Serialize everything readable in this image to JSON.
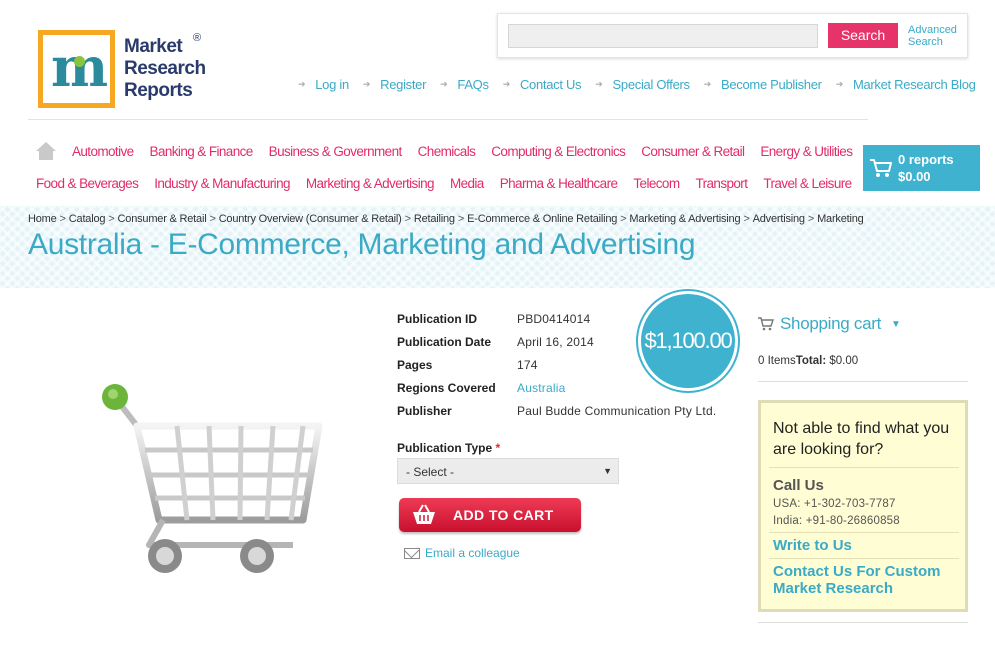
{
  "brand": {
    "logo_letter": "m",
    "logo_lines": [
      "Market",
      "Research",
      "Reports"
    ],
    "registered": "®"
  },
  "search": {
    "placeholder": "",
    "button_label": "Search",
    "advanced_label": "Advanced Search"
  },
  "top_links": [
    "Log in",
    "Register",
    "FAQs",
    "Contact Us",
    "Special Offers",
    "Become Publisher",
    "Market Research Blog"
  ],
  "categories_row1": [
    "Automotive",
    "Banking & Finance",
    "Business & Government",
    "Chemicals",
    "Computing & Electronics",
    "Consumer & Retail",
    "Energy & Utilities"
  ],
  "categories_row2": [
    "Food & Beverages",
    "Industry & Manufacturing",
    "Marketing & Advertising",
    "Media",
    "Pharma & Healthcare",
    "Telecom",
    "Transport",
    "Travel & Leisure"
  ],
  "cart_summary": {
    "reports": "0 reports",
    "amount": "$0.00"
  },
  "breadcrumb": [
    "Home",
    "Catalog",
    "Consumer & Retail",
    "Country Overview (Consumer & Retail)",
    "Retailing",
    "E-Commerce & Online Retailing",
    "Marketing & Advertising",
    "Advertising",
    "Marketing"
  ],
  "page_title": "Australia - E-Commerce, Marketing and Advertising",
  "details": {
    "publication_id_label": "Publication ID",
    "publication_id": "PBD0414014",
    "publication_date_label": "Publication Date",
    "publication_date": "April 16, 2014",
    "pages_label": "Pages",
    "pages": "174",
    "regions_label": "Regions Covered",
    "regions": "Australia",
    "publisher_label": "Publisher",
    "publisher": "Paul Budde Communication Pty Ltd."
  },
  "price": "$1,100.00",
  "publication_type": {
    "label": "Publication Type",
    "required_mark": "*",
    "selected": "- Select -"
  },
  "add_to_cart_label": "ADD TO CART",
  "email_colleague_label": "Email a colleague",
  "shopping_cart": {
    "title": "Shopping cart",
    "items_text": "0 Items",
    "total_label": "Total:",
    "total_value": "$0.00"
  },
  "help_box": {
    "question": "Not able to find what you are looking for?",
    "call_us": "Call Us",
    "usa": "USA: +1-302-703-7787",
    "india": "India: +91-80-26860858",
    "write_to_us": "Write to Us",
    "custom_research": "Contact Us For Custom Market Research"
  },
  "colors": {
    "brand_blue": "#3aaac6",
    "category_pink": "#e22c6a",
    "search_button": "#e6336a",
    "cart_box": "#3fb2cf",
    "add_to_cart": "#d41e3a",
    "help_box_bg": "#fefdd4"
  }
}
